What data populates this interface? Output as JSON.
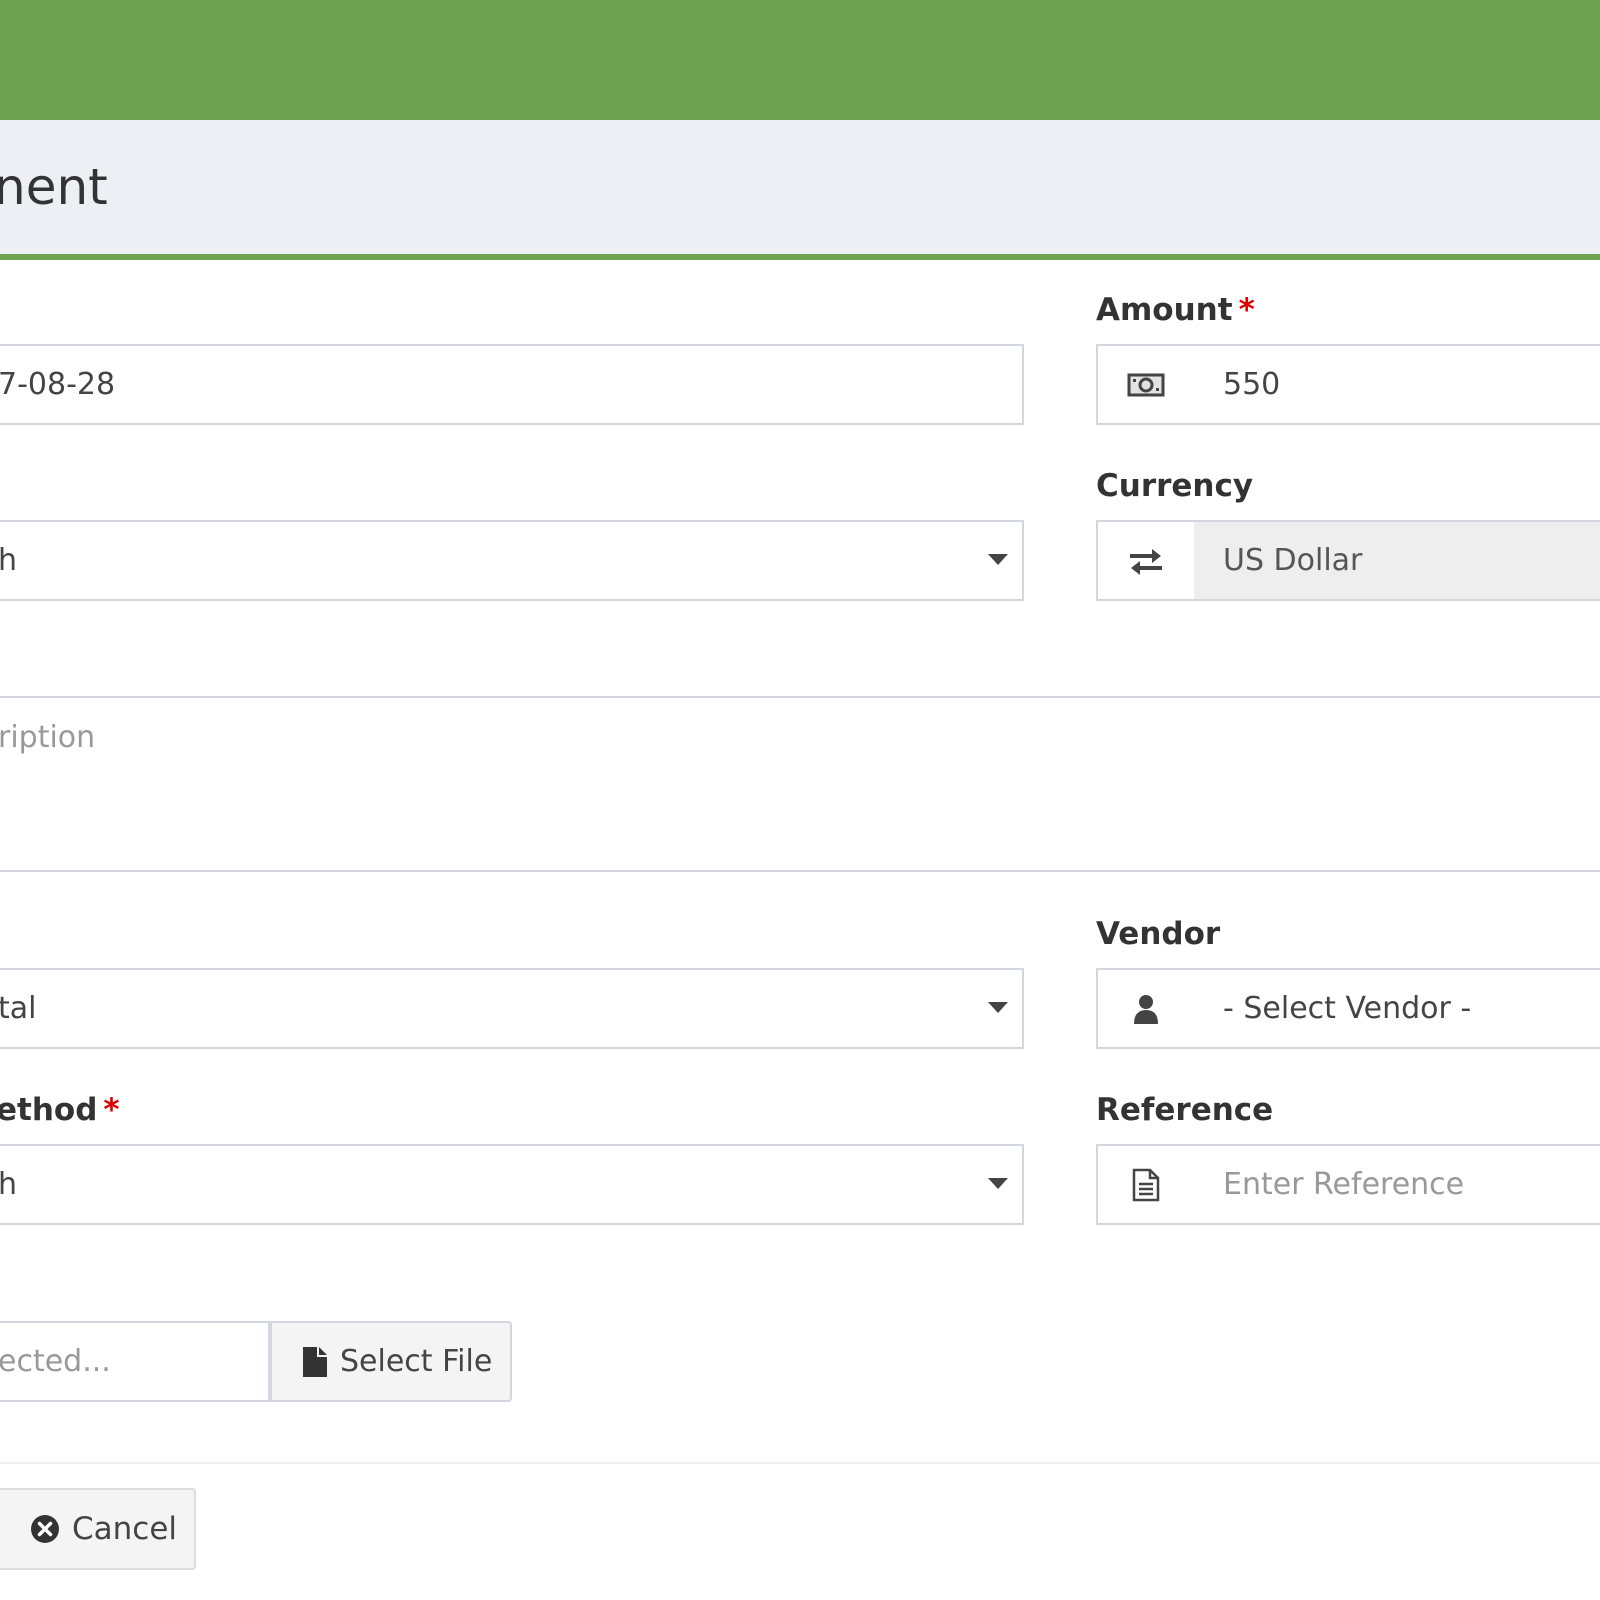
{
  "header": {
    "title": "nent"
  },
  "form": {
    "date": {
      "value": "7-08-28"
    },
    "amount": {
      "label": "Amount",
      "required_mark": "*",
      "value": "550",
      "icon": "money-icon"
    },
    "account": {
      "value": "h"
    },
    "currency": {
      "label": "Currency",
      "value": "US Dollar",
      "icon": "exchange-icon"
    },
    "description": {
      "placeholder": "ription"
    },
    "category": {
      "value": "tal"
    },
    "vendor": {
      "label": "Vendor",
      "value": "- Select Vendor -",
      "icon": "user-icon"
    },
    "payment_method": {
      "label": "ethod",
      "required_mark": "*",
      "value": "h"
    },
    "reference": {
      "label": "Reference",
      "placeholder": "Enter Reference",
      "icon": "file-text-icon"
    },
    "attachment": {
      "placeholder": "ected...",
      "button_label": "Select File",
      "icon": "file-icon"
    }
  },
  "actions": {
    "cancel_label": "Cancel",
    "cancel_icon": "times-circle-icon"
  },
  "colors": {
    "accent": "#6da252",
    "title_bg": "#ecf0f5",
    "required": "#dd0000",
    "border": "#d2d6de"
  }
}
